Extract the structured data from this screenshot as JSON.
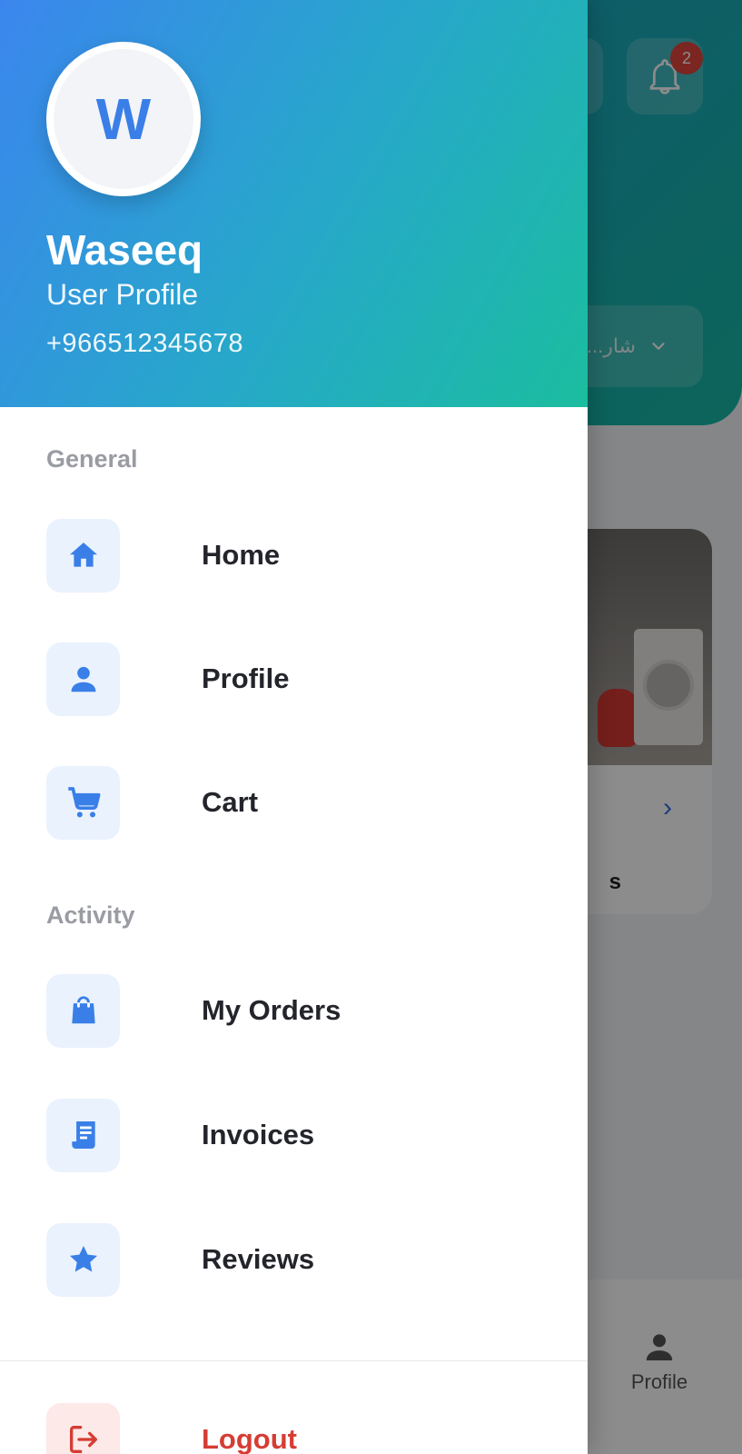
{
  "background": {
    "notification_count": "2",
    "location_text": "...شار",
    "bottom_nav_profile_label": "Profile",
    "card_partial_text": "s"
  },
  "drawer": {
    "avatar_initial": "W",
    "user_name": "Waseeq",
    "user_subtitle": "User Profile",
    "user_phone": "+966512345678",
    "sections": {
      "general": {
        "label": "General",
        "items": [
          {
            "label": "Home",
            "icon": "home-icon"
          },
          {
            "label": "Profile",
            "icon": "person-icon"
          },
          {
            "label": "Cart",
            "icon": "cart-icon"
          }
        ]
      },
      "activity": {
        "label": "Activity",
        "items": [
          {
            "label": "My Orders",
            "icon": "shopping-bag-icon"
          },
          {
            "label": "Invoices",
            "icon": "receipt-icon"
          },
          {
            "label": "Reviews",
            "icon": "star-icon"
          }
        ]
      }
    },
    "logout": {
      "label": "Logout",
      "icon": "logout-icon"
    }
  },
  "colors": {
    "accent": "#3a7fe8",
    "header_gradient_start": "#3b86ee",
    "header_gradient_end": "#1bbd9f",
    "danger": "#d63c33"
  }
}
